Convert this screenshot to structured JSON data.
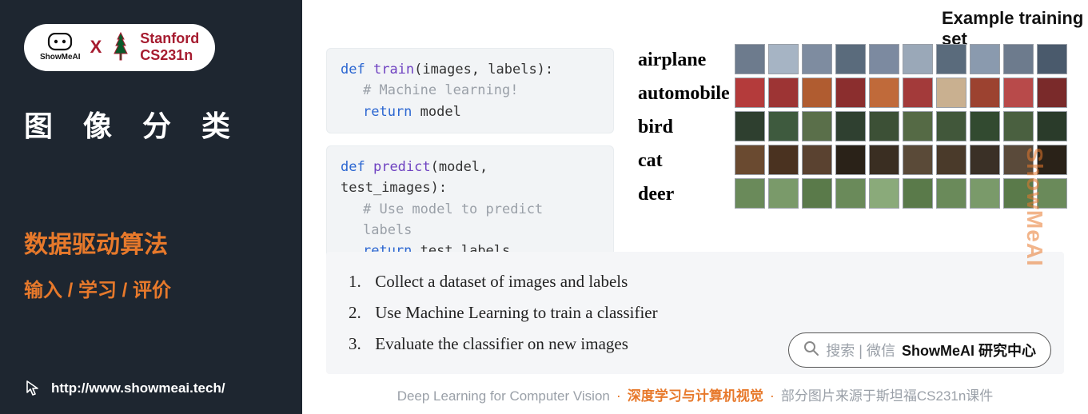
{
  "sidebar": {
    "brand_logo_text": "ShowMeAI",
    "x": "X",
    "course_line1": "Stanford",
    "course_line2": "CS231n",
    "heading": "图像分类",
    "highlight_line1": "数据驱动算法",
    "highlight_line2": "输入 / 学习 / 评价",
    "site_url": "http://www.showmeai.tech/"
  },
  "main": {
    "code_train": {
      "def": "def",
      "fn": "train",
      "sig": "(images, labels):",
      "comment": "# Machine learning!",
      "ret_kw": "return",
      "ret_val": "model"
    },
    "code_predict": {
      "def": "def",
      "fn": "predict",
      "sig": "(model, test_images):",
      "comment": "# Use model to predict labels",
      "ret_kw": "return",
      "ret_val": "test_labels"
    },
    "example_title": "Example training set",
    "class_labels": [
      "airplane",
      "automobile",
      "bird",
      "cat",
      "deer"
    ],
    "thumb_colors": [
      "#6d7b8d",
      "#a6b4c4",
      "#7e8ca0",
      "#5a6b7c",
      "#7c8aa0",
      "#9aa8b8",
      "#5a6b7c",
      "#8a9aae",
      "#6d7b8d",
      "#4a5a6c",
      "#b43b3b",
      "#9d3434",
      "#b05c30",
      "#8b2e2e",
      "#c06a3a",
      "#a33a3a",
      "#c9b090",
      "#9c4230",
      "#b84a4a",
      "#7a2a2a",
      "#2e3f2f",
      "#3e5a3e",
      "#5a6f4a",
      "#2f4030",
      "#3c5036",
      "#556a45",
      "#41573a",
      "#324a30",
      "#4a6040",
      "#2a3b2a",
      "#6a4a30",
      "#4a3220",
      "#5a4230",
      "#2a2218",
      "#3a2e22",
      "#5a4a38",
      "#4a3a2a",
      "#3a3026",
      "#5a4a3a",
      "#2a2218",
      "#6a8a5a",
      "#7a9a6a",
      "#5a7a4a",
      "#6a8a5a",
      "#8aaa7a",
      "#5a7a4a",
      "#6a8a5a",
      "#7a9a6a",
      "#5a7a4a",
      "#6a8a5a"
    ],
    "steps": [
      "Collect a dataset of images and labels",
      "Use Machine Learning to train a classifier",
      "Evaluate the classifier on new images"
    ],
    "search": {
      "hint": "搜索 | 微信",
      "brand": "ShowMeAI 研究中心"
    },
    "footer": {
      "left": "Deep Learning for Computer Vision",
      "mid": "深度学习与计算机视觉",
      "right": "部分图片来源于斯坦福CS231n课件",
      "dot": "·"
    },
    "watermark": "ShowMeAI"
  }
}
